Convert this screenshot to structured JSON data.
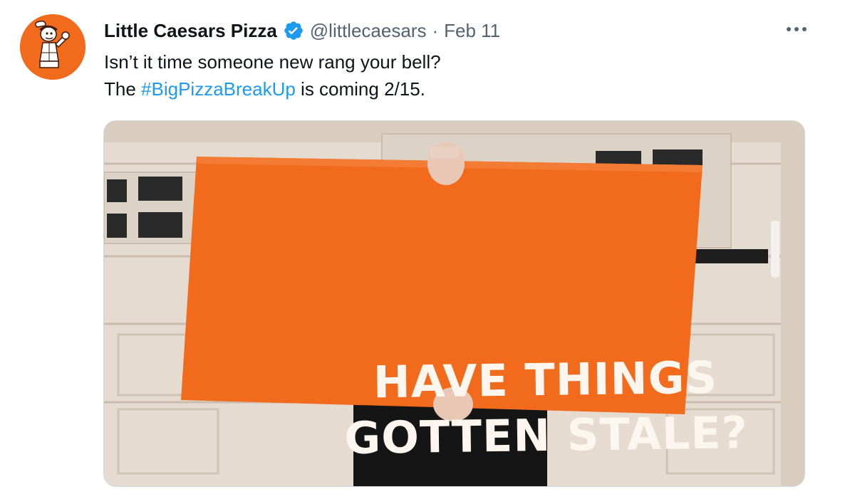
{
  "tweet": {
    "author": {
      "display_name": "Little Caesars Pizza",
      "handle": "@littlecaesars",
      "verified": true,
      "avatar_icon": "little-caesars-logo"
    },
    "separator": "·",
    "date": "Feb 11",
    "text_line1": "Isn’t it time someone new rang your bell?",
    "text_line2_prefix": "The ",
    "hashtag": "#BigPizzaBreakUp",
    "text_line2_suffix": " is coming 2/15.",
    "more_icon": "more-horizontal-icon",
    "media": {
      "sign_line1": "HAVE THINGS",
      "sign_line2": "GOTTEN STALE?"
    }
  },
  "colors": {
    "brand_orange": "#f26b1d",
    "link_blue": "#1d9bf0",
    "verified_blue": "#1d9bf0",
    "secondary_text": "#536471"
  }
}
